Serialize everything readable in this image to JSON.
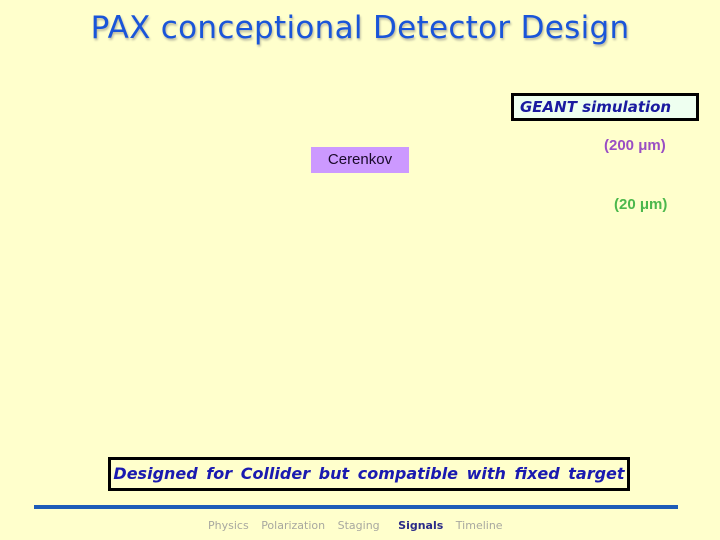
{
  "slide": {
    "title": "PAX conceptional Detector Design",
    "geant_label": "GEANT simulation",
    "annotation_200": "(200 μm)",
    "annotation_20": "(20 μm)",
    "cerenkov_label": "Cerenkov",
    "footer_box": "Designed for Collider but compatible with fixed target"
  },
  "nav": {
    "items": [
      {
        "label": "Physics",
        "active": false
      },
      {
        "label": "Polarization",
        "active": false
      },
      {
        "label": "Staging",
        "active": false
      },
      {
        "label": "Signals",
        "active": true
      },
      {
        "label": "Timeline",
        "active": false
      }
    ]
  },
  "colors": {
    "background": "#ffffcc",
    "title": "#1a55d9",
    "rule": "#1d5cb8",
    "cerenkov_fill": "#cc99ff",
    "um200": "#9a4ec4",
    "um20": "#4cb84c"
  }
}
